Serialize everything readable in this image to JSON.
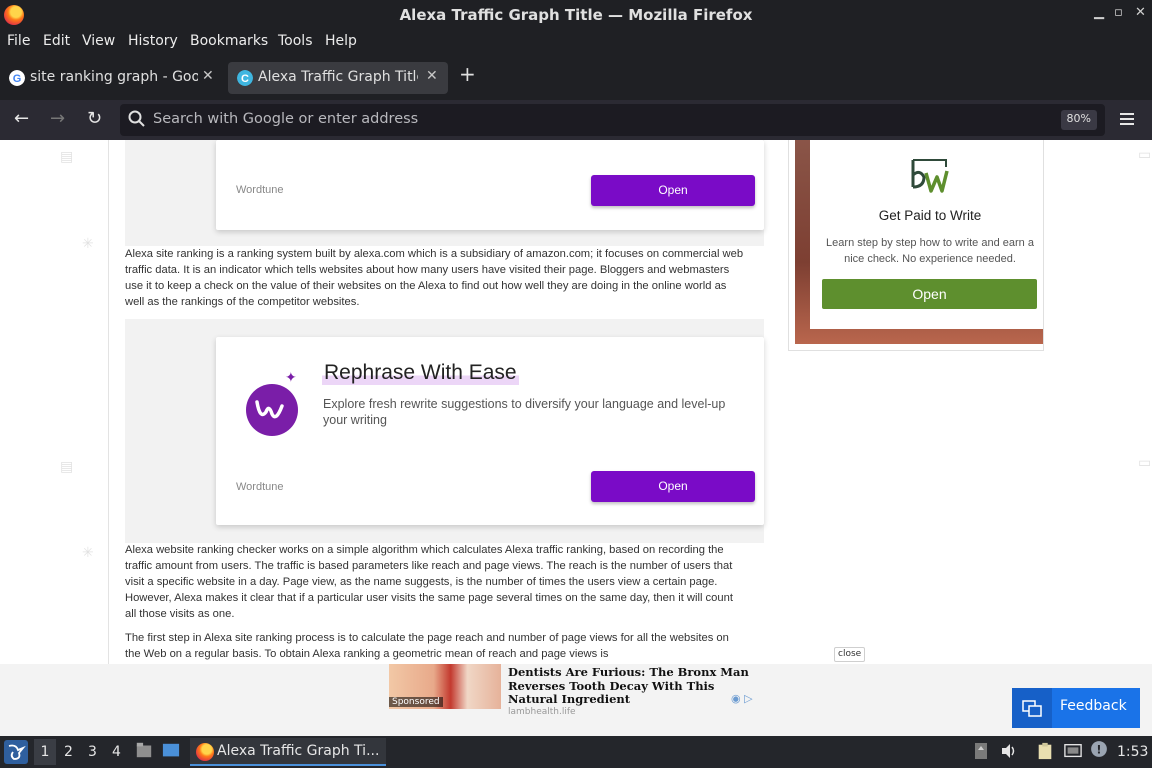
{
  "window": {
    "title": "Alexa Traffic Graph Title — Mozilla Firefox"
  },
  "menu": [
    "File",
    "Edit",
    "View",
    "History",
    "Bookmarks",
    "Tools",
    "Help"
  ],
  "tabs": [
    {
      "label": "site ranking graph - Goog",
      "active": false
    },
    {
      "label": "Alexa Traffic Graph Title",
      "active": true
    }
  ],
  "navbar": {
    "url_placeholder": "Search with Google or enter address",
    "zoom": "80%"
  },
  "page": {
    "ad_top": {
      "brand": "Wordtune",
      "open_label": "Open"
    },
    "paragraph_1": "Alexa site ranking is a ranking system built by alexa.com which is a subsidiary of amazon.com; it focuses on commercial web traffic data. It is an indicator which tells websites about how many users have visited their page. Bloggers and webmasters use it to keep a check on the value of their websites on the Alexa to find out how well they are doing in the online world as well as the rankings of the competitor websites.",
    "ad_main": {
      "headline": "Rephrase With Ease",
      "description": "Explore fresh rewrite suggestions to diversify your language and level-up your writing",
      "brand": "Wordtune",
      "open_label": "Open"
    },
    "paragraph_2": "Alexa website ranking checker works on a simple algorithm which calculates Alexa traffic ranking, based on recording the traffic amount from users. The traffic is based parameters like reach and page views. The reach is the number of users that visit a specific website in a day. Page view, as the name suggests, is the number of times the users view a certain page. However, Alexa makes it clear that if a particular user visits the same page several times on the same day, then it will count all those visits as one.",
    "paragraph_3": "The first step in Alexa site ranking process is to calculate the page reach and number of page views for all the websites on the Web on a regular basis. To obtain Alexa ranking a geometric mean of reach and page views is"
  },
  "side_ad": {
    "title": "Get Paid to Write",
    "description": "Learn step by step how to write and earn a nice check. No experience needed.",
    "open_label": "Open"
  },
  "bottom_ad": {
    "sponsored": "Sponsored",
    "headline": "Dentists Are Furious: The Bronx Man Reverses Tooth Decay With This Natural Ingredient",
    "source": "lambhealth.life",
    "close_label": "close"
  },
  "feedback": {
    "label": "Feedback"
  },
  "taskbar": {
    "workspaces": [
      "1",
      "2",
      "3",
      "4"
    ],
    "active_window": "Alexa Traffic Graph Ti...",
    "clock": "1:53"
  },
  "colors": {
    "chrome_dark": "#1f2024",
    "ad_purple": "#7a0bc7",
    "side_ad_green": "#5e8f2e",
    "feedback_blue": "#1a73e8"
  }
}
